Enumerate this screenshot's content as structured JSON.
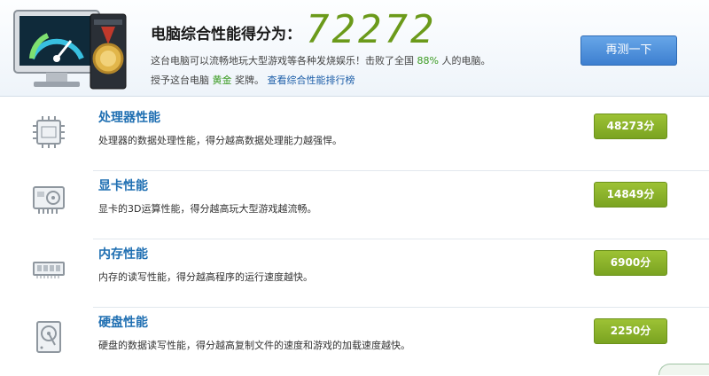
{
  "header": {
    "title": "电脑综合性能得分为：",
    "score": "72272",
    "desc_prefix": "这台电脑可以流畅地玩大型游戏等各种发烧娱乐！击败了全国",
    "desc_percent": "88%",
    "desc_suffix": "人的电脑。",
    "award_prefix": "授予这台电脑",
    "award_level": "黄金",
    "award_suffix": "奖牌。",
    "ranking_link": "查看综合性能排行榜",
    "retest_label": "再测一下"
  },
  "items": [
    {
      "title": "处理器性能",
      "desc": "处理器的数据处理性能，得分越高数据处理能力越强悍。",
      "score": "48273分",
      "icon": "cpu-icon"
    },
    {
      "title": "显卡性能",
      "desc": "显卡的3D运算性能，得分越高玩大型游戏越流畅。",
      "score": "14849分",
      "icon": "graphics-card-icon"
    },
    {
      "title": "内存性能",
      "desc": "内存的读写性能，得分越高程序的运行速度越快。",
      "score": "6900分",
      "icon": "memory-icon"
    },
    {
      "title": "硬盘性能",
      "desc": "硬盘的数据读写性能，得分越高复制文件的速度和游戏的加载速度越快。",
      "score": "2250分",
      "icon": "hard-disk-icon"
    }
  ],
  "colors": {
    "accent_blue": "#1f6fb2",
    "score_green": "#6b9a1a",
    "badge_green": "#8ab42b",
    "button_blue": "#4a8fdc"
  }
}
